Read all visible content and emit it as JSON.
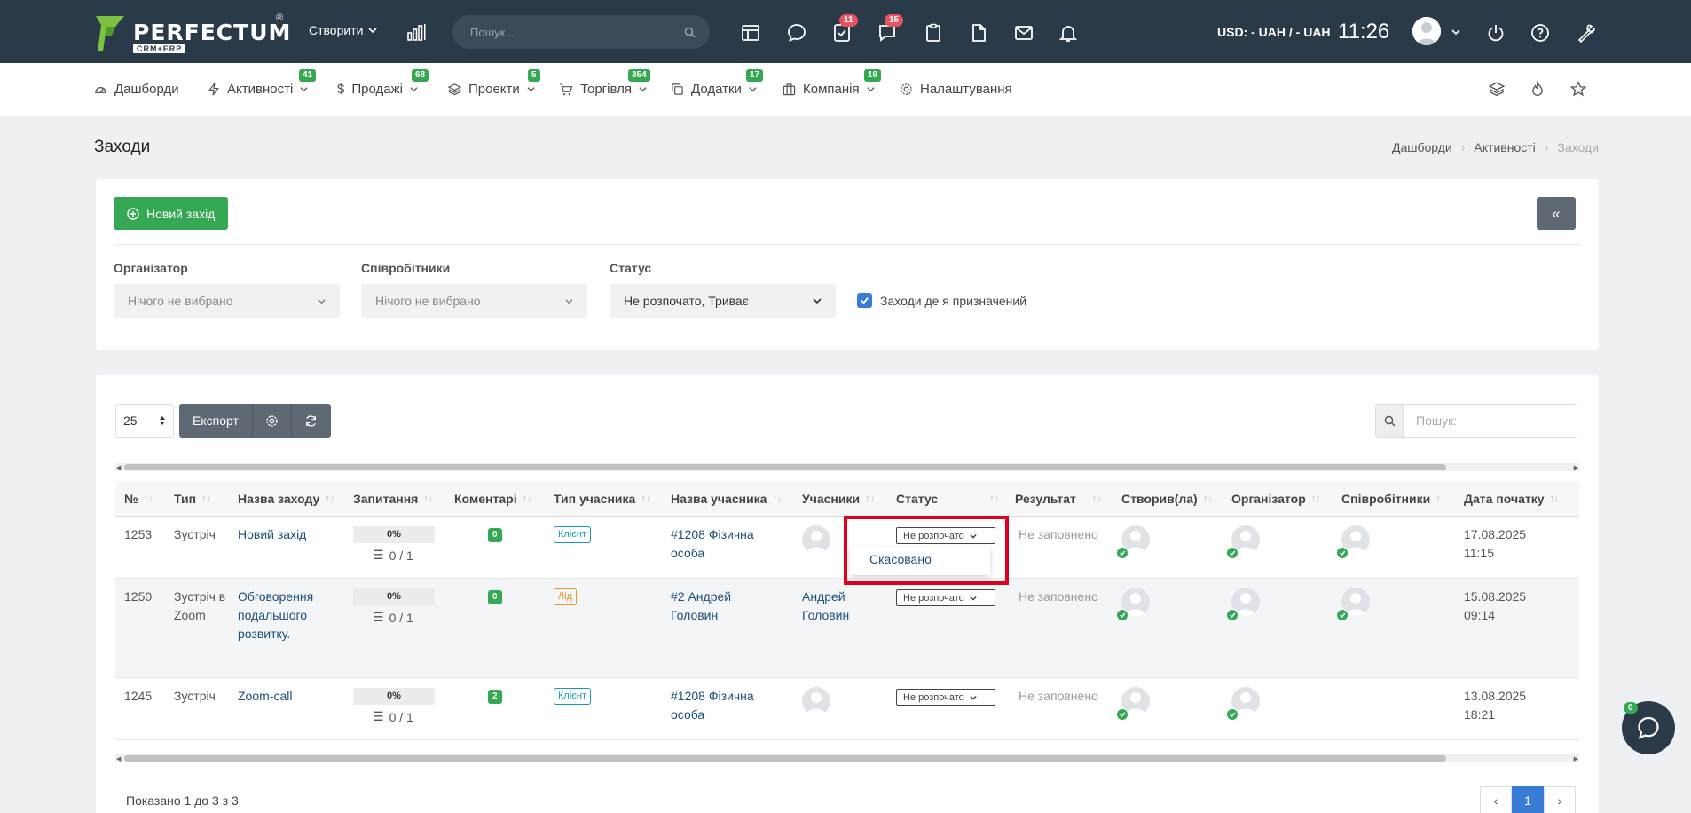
{
  "topbar": {
    "logo_text": "PERFECTUM",
    "logo_reg": "®",
    "logo_sub": "CRM+ERP",
    "create_label": "Створити",
    "search_placeholder": "Пошук...",
    "badge_tasks": "11",
    "badge_chat": "15",
    "currency": "USD: - UAH / - UAH",
    "time": "11:26"
  },
  "nav": [
    {
      "label": "Дашборди",
      "badge": ""
    },
    {
      "label": "Активності",
      "badge": "41"
    },
    {
      "label": "Продажі",
      "badge": "68"
    },
    {
      "label": "Проекти",
      "badge": "5"
    },
    {
      "label": "Торгівля",
      "badge": "354"
    },
    {
      "label": "Додатки",
      "badge": "17"
    },
    {
      "label": "Компанія",
      "badge": "19"
    },
    {
      "label": "Налаштування",
      "badge": ""
    }
  ],
  "page": {
    "title": "Заходи",
    "breadcrumb": [
      "Дашборди",
      "Активності",
      "Заходи"
    ]
  },
  "filters": {
    "new_button": "Новий захід",
    "collapse": "«",
    "organizer_label": "Організатор",
    "organizer_value": "Нічого не вибрано",
    "employees_label": "Співробітники",
    "employees_value": "Нічого не вибрано",
    "status_label": "Статус",
    "status_value": "Не розпочато, Триває",
    "assigned_label": "Заходи де я призначений"
  },
  "table": {
    "page_size": "25",
    "export_label": "Експорт",
    "search_placeholder": "Пошук:",
    "columns": [
      "№",
      "Тип",
      "Назва заходу",
      "Запитання",
      "Коментарі",
      "Тип учасника",
      "Назва учасника",
      "Учасники",
      "Статус",
      "Результат",
      "Створив(ла)",
      "Організатор",
      "Співробітники",
      "Дата початку"
    ],
    "rows": [
      {
        "id": "1253",
        "type": "Зустріч",
        "name": "Новий захід",
        "progress": "0%",
        "subtasks": "0 / 1",
        "comments": "0",
        "ptype": "Клієнт",
        "pname": "#1208 Фізична особа",
        "participants": "",
        "status": "Не розпочато",
        "result": "Не заповнено",
        "date": "17.08.2025 11:15"
      },
      {
        "id": "1250",
        "type": "Зустріч в Zoom",
        "name": "Обговорення подальшого розвитку.",
        "progress": "0%",
        "subtasks": "0 / 1",
        "comments": "0",
        "ptype": "Лід",
        "pname": "#2 Андрей Головин",
        "participants": "Андрей Головин",
        "status": "Не розпочато",
        "result": "Не заповнено",
        "date": "15.08.2025 09:14"
      },
      {
        "id": "1245",
        "type": "Зустріч",
        "name": "Zoom-call",
        "progress": "0%",
        "subtasks": "0 / 1",
        "comments": "2",
        "ptype": "Клієнт",
        "pname": "#1208 Фізична особа",
        "participants": "",
        "status": "Не розпочато",
        "result": "Не заповнено",
        "date": "13.08.2025 18:21"
      }
    ],
    "dropdown_option": "Скасовано",
    "showing": "Показано 1 до 3 з 3",
    "current_page": "1",
    "prev": "‹",
    "next": "›"
  },
  "chat": {
    "badge": "0"
  },
  "colors": {
    "topbar": "#2b3a48",
    "accent_green": "#34a853",
    "badge_red": "#e8535f",
    "link": "#1f4e79",
    "highlight": "#e0001b"
  }
}
